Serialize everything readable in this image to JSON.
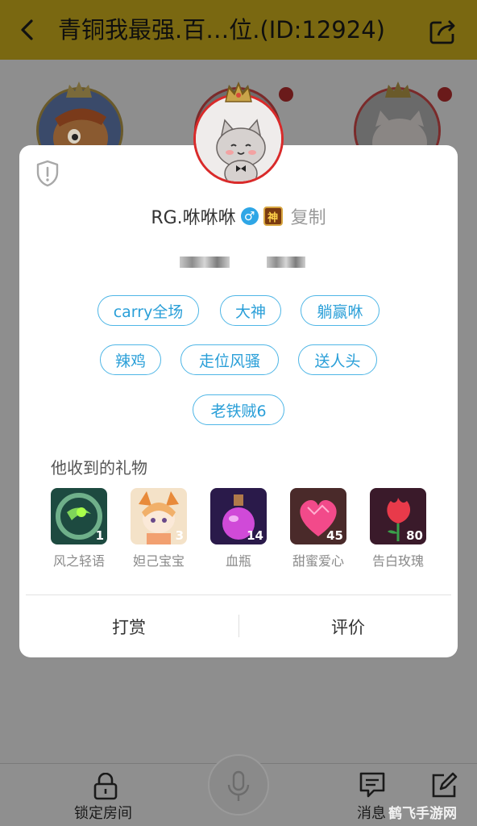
{
  "header": {
    "title": "青铜我最强.百…位.(ID:12924)"
  },
  "profile": {
    "name": "RG.咻咻咻",
    "gender_symbol": "♂",
    "badge_text": "神",
    "copy_label": "复制"
  },
  "tags": [
    "carry全场",
    "大神",
    "躺赢咻",
    "辣鸡",
    "走位风骚",
    "送人头",
    "老铁贼6"
  ],
  "gifts": {
    "title": "他收到的礼物",
    "items": [
      {
        "name": "风之轻语",
        "count": "1"
      },
      {
        "name": "妲己宝宝",
        "count": "3"
      },
      {
        "name": "血瓶",
        "count": "14"
      },
      {
        "name": "甜蜜爱心",
        "count": "45"
      },
      {
        "name": "告白玫瑰",
        "count": "80"
      }
    ]
  },
  "actions": {
    "reward": "打赏",
    "review": "评价"
  },
  "bottom": {
    "lock_label": "锁定房间",
    "message_label": "消息"
  },
  "watermark": "鹤飞手游网",
  "colors": {
    "accent": "#2ea6e6",
    "header_bg": "#e8c41f",
    "tag_border": "#4fb6e6"
  }
}
